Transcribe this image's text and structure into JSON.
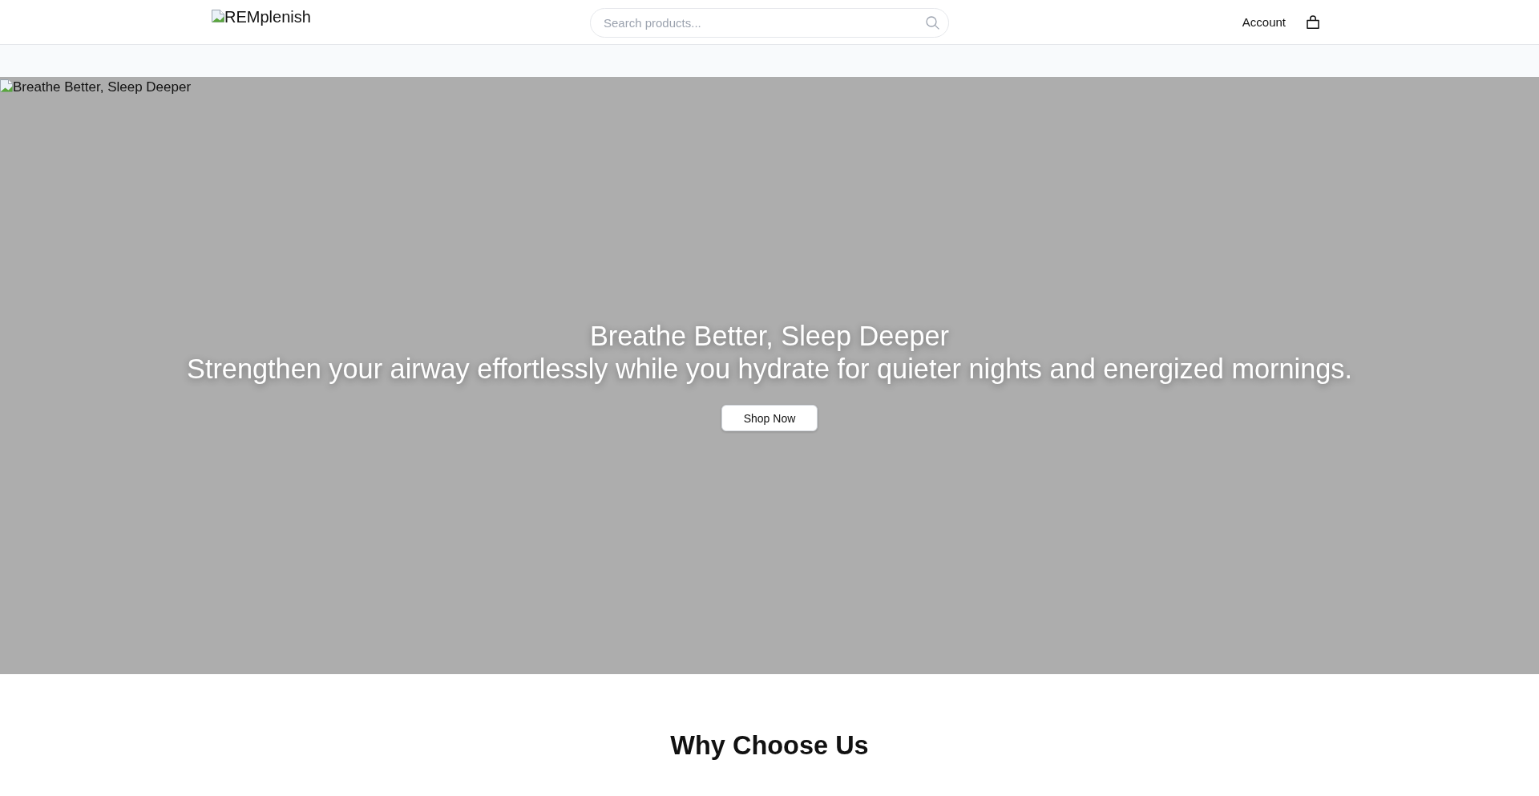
{
  "header": {
    "logo_alt": "REMplenish",
    "search": {
      "placeholder": "Search products..."
    },
    "account_link": "Account"
  },
  "hero": {
    "image_alt": "Breathe Better, Sleep Deeper",
    "title": "Breathe Better, Sleep Deeper",
    "subtitle": "Strengthen your airway effortlessly while you hydrate for quieter nights and energized mornings.",
    "button": "Shop Now"
  },
  "features": {
    "title": "Why Choose Us"
  }
}
